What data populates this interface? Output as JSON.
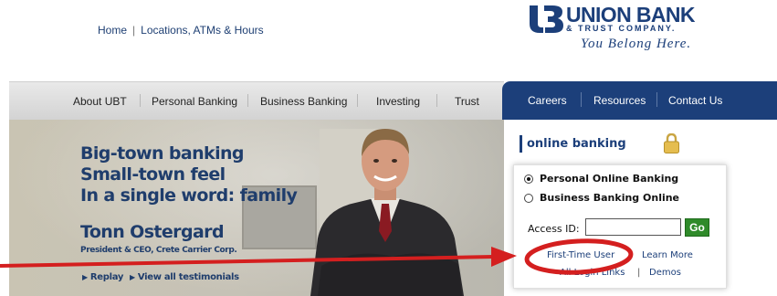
{
  "top_links": {
    "home": "Home",
    "separator": "|",
    "locations": "Locations, ATMs & Hours"
  },
  "logo": {
    "name": "UNION BANK",
    "sub": "& TRUST COMPANY.",
    "tagline": "You Belong Here."
  },
  "nav": {
    "gray_items": [
      "About UBT",
      "Personal Banking",
      "Business Banking",
      "Investing",
      "Trust"
    ],
    "blue_items": [
      "Careers",
      "Resources",
      "Contact Us"
    ]
  },
  "hero": {
    "headlines": [
      "Big-town banking",
      "Small-town feel",
      "In a single word: family"
    ],
    "person_name": "Tonn Ostergard",
    "person_title": "President & CEO, Crete Carrier Corp.",
    "replay": "Replay",
    "view_all": "View all testimonials"
  },
  "online_banking": {
    "title": "online banking",
    "options": [
      "Personal Online Banking",
      "Business Banking Online"
    ],
    "selected": "Personal Online Banking",
    "access_label": "Access ID:",
    "access_value": "",
    "go": "Go",
    "first_time": "First-Time User",
    "learn_more": "Learn More",
    "all_login": "All Login Links",
    "separator": "|",
    "demos": "Demos"
  },
  "colors": {
    "brand_blue": "#1c3f7a",
    "go_green": "#2f8a2a",
    "annotation_red": "#d41f1f"
  },
  "icons": [
    "lock-icon",
    "arrow-annotation",
    "circle-annotation"
  ]
}
